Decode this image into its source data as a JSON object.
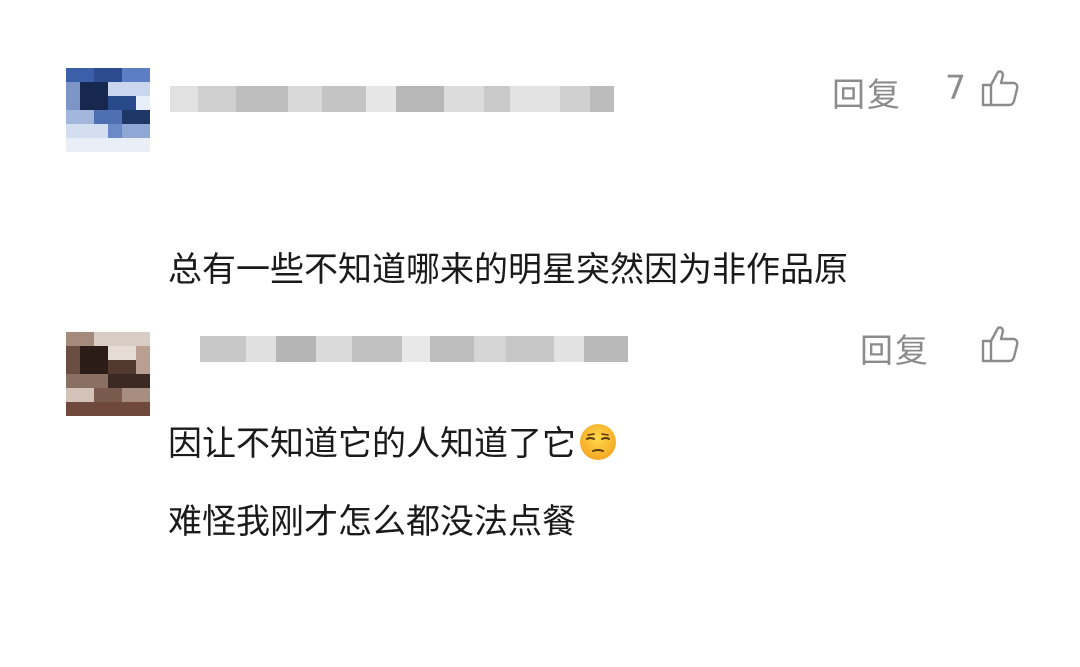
{
  "comments": [
    {
      "reply_label": "回复",
      "like_count": "7",
      "text_line1": "总有一些不知道哪来的明星突然因为非作品原",
      "text_line2": "因让不知道它的人知道了它",
      "emoji": "unamused-face-icon"
    },
    {
      "reply_label": "回复",
      "like_count": "",
      "text_line1": "难怪我刚才怎么都没法点餐"
    }
  ],
  "icons": {
    "like": "thumbs-up-outline-icon"
  },
  "colors": {
    "meta_gray": "#8b8b8b",
    "text": "#1a1a1a",
    "background": "#ffffff"
  }
}
